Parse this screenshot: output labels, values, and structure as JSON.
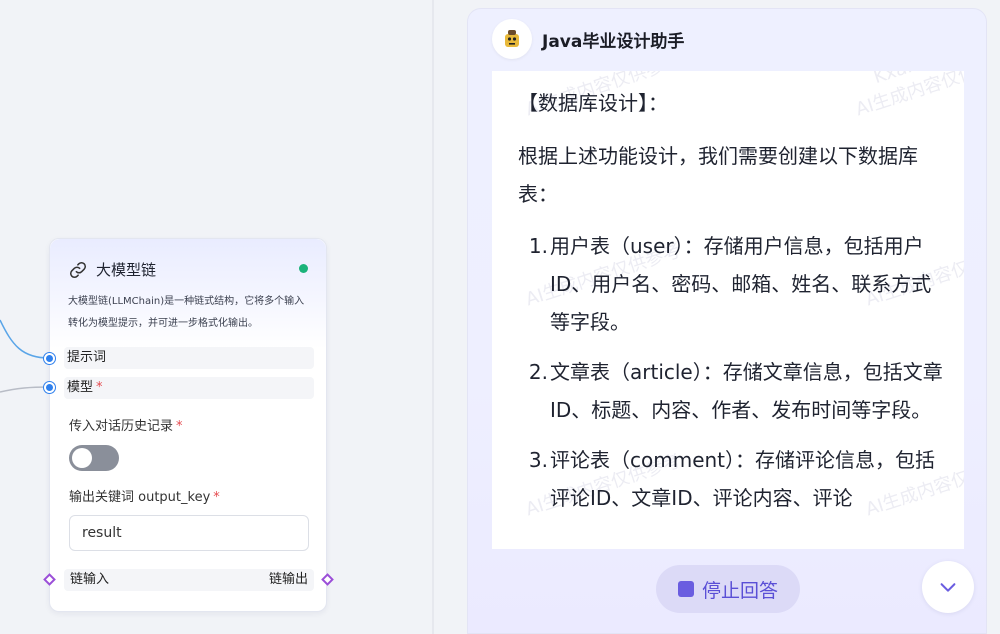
{
  "node": {
    "title": "大模型链",
    "description": "大模型链(LLMChain)是一种链式结构，它将多个输入转化为模型提示，并可进一步格式化输出。",
    "status_color": "#1bb37a",
    "ports": [
      {
        "label": "提示词",
        "required": false
      },
      {
        "label": "模型",
        "required": true
      }
    ],
    "history_label": "传入对话历史记录",
    "history_required": true,
    "history_enabled": false,
    "output_key_label": "输出关键词 output_key",
    "output_key_required": true,
    "output_key_value": "result",
    "chain_input": "链输入",
    "chain_output": "链输出",
    "required_mark": "*"
  },
  "chat": {
    "title": "Java毕业设计助手",
    "section_title": "【数据库设计】：",
    "intro": "根据上述功能设计，我们需要创建以下数据库表：",
    "items": [
      {
        "num": "1.",
        "text": "用户表（user）：存储用户信息，包括用户ID、用户名、密码、邮箱、姓名、联系方式等字段。"
      },
      {
        "num": "2.",
        "text": "文章表（article）：存储文章信息，包括文章ID、标题、内容、作者、发布时间等字段。"
      },
      {
        "num": "3.",
        "text": "评论表（comment）：存储评论信息，包括评论ID、文章ID、评论内容、评论"
      }
    ],
    "stop_label": "停止回答",
    "accent_color": "#6a5de0"
  },
  "icons": {
    "node_icon": "link-icon",
    "scroll_icon": "chevron-down-icon",
    "stop_icon": "stop-icon",
    "avatar_icon": "bot-avatar-icon"
  }
}
